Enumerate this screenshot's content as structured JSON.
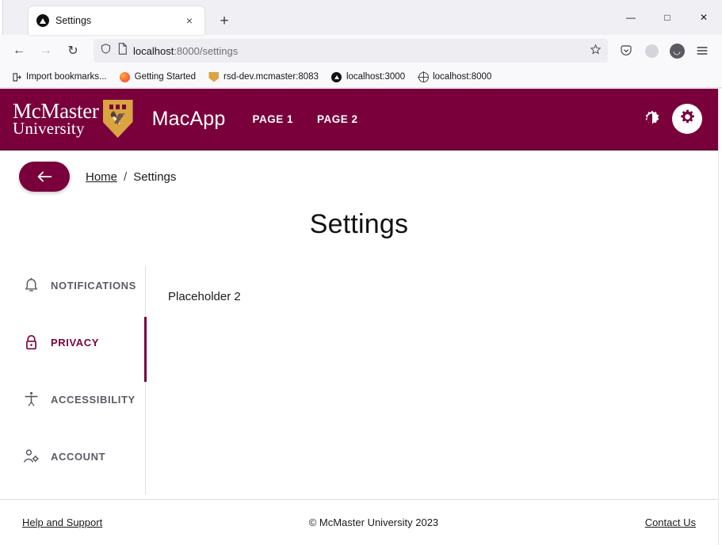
{
  "browser": {
    "tab": {
      "title": "Settings",
      "favicon": "nextjs-triangle-icon",
      "close": "×"
    },
    "new_tab": "+",
    "window_controls": {
      "minimize": "—",
      "maximize": "□",
      "close": "✕"
    },
    "nav": {
      "back": "←",
      "forward": "→",
      "reload": "↻"
    },
    "url": {
      "host": "localhost",
      "rest": ":8000/settings",
      "shield_icon": "shield-icon",
      "page_icon": "page-icon",
      "star_icon": "star-icon"
    },
    "toolbar_icons": {
      "pocket": "pocket-icon",
      "account": "account-circle-icon",
      "extension": "extension-icon",
      "menu": "hamburger-menu-icon"
    },
    "bookmarks": [
      {
        "label": "Import bookmarks...",
        "icon": "import-icon"
      },
      {
        "label": "Getting Started",
        "icon": "firefox-icon"
      },
      {
        "label": "rsd-dev.mcmaster:8083",
        "icon": "mcmaster-crest-icon"
      },
      {
        "label": "localhost:3000",
        "icon": "nextjs-triangle-icon"
      },
      {
        "label": "localhost:8000",
        "icon": "globe-icon"
      }
    ]
  },
  "app": {
    "brand": {
      "mcmaster": "McMaster",
      "university": "University",
      "crest": "mcmaster-crest-icon"
    },
    "name": "MacApp",
    "nav_links": [
      "PAGE 1",
      "PAGE 2"
    ],
    "actions": {
      "dark_mode": "dark-mode-toggle-icon",
      "settings": "gear-icon"
    }
  },
  "breadcrumb": {
    "back_arrow": "←",
    "home": "Home",
    "separator": "/",
    "current": "Settings"
  },
  "page": {
    "title": "Settings"
  },
  "settings_tabs": [
    {
      "label": "NOTIFICATIONS",
      "icon": "bell-icon",
      "active": false
    },
    {
      "label": "PRIVACY",
      "icon": "lock-icon",
      "active": true
    },
    {
      "label": "ACCESSIBILITY",
      "icon": "accessibility-icon",
      "active": false
    },
    {
      "label": "ACCOUNT",
      "icon": "account-gear-icon",
      "active": false
    }
  ],
  "panel": {
    "content": "Placeholder 2"
  },
  "footer": {
    "help": "Help and Support",
    "copyright": "© McMaster University 2023",
    "contact": "Contact Us"
  },
  "colors": {
    "brand_maroon": "#7A003C",
    "crest_gold": "#D9A441",
    "tab_inactive_text": "#5B5B66",
    "chrome_bg": "#F0F0F4"
  }
}
